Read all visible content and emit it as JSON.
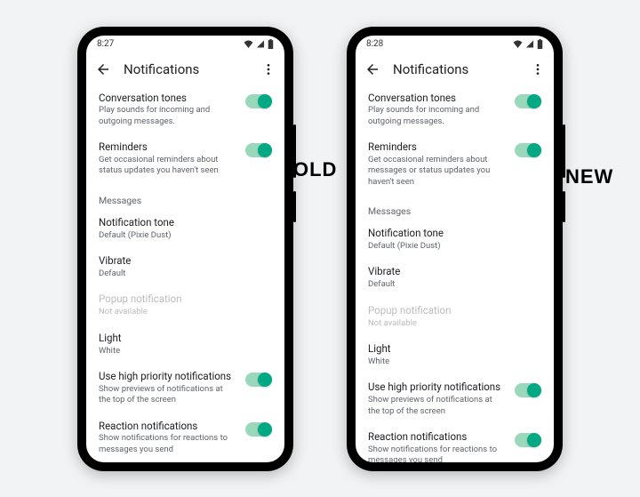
{
  "badges": {
    "old": "OLD",
    "new": "NEW"
  },
  "phones": [
    {
      "id": "old",
      "status_time": "8:27",
      "title": "Notifications",
      "settings": {
        "conv_title": "Conversation tones",
        "conv_sub": "Play sounds for incoming and outgoing messages.",
        "rem_title": "Reminders",
        "rem_sub": "Get occasional reminders about status updates you haven't seen",
        "section_messages": "Messages",
        "tone_title": "Notification tone",
        "tone_sub": "Default (Pixie Dust)",
        "vib_title": "Vibrate",
        "vib_sub": "Default",
        "popup_title": "Popup notification",
        "popup_sub": "Not available",
        "light_title": "Light",
        "light_sub": "White",
        "hp_title": "Use high priority notifications",
        "hp_sub": "Show previews of notifications at the top of the screen",
        "react_title": "Reaction notifications",
        "react_sub": "Show notifications for reactions to messages you send"
      }
    },
    {
      "id": "new",
      "status_time": "8:28",
      "title": "Notifications",
      "settings": {
        "conv_title": "Conversation tones",
        "conv_sub": "Play sounds for incoming and outgoing messages.",
        "rem_title": "Reminders",
        "rem_sub": "Get occasional reminders about messages or status updates you haven't seen",
        "section_messages": "Messages",
        "tone_title": "Notification tone",
        "tone_sub": "Default (Pixie Dust)",
        "vib_title": "Vibrate",
        "vib_sub": "Default",
        "popup_title": "Popup notification",
        "popup_sub": "Not available",
        "light_title": "Light",
        "light_sub": "White",
        "hp_title": "Use high priority notifications",
        "hp_sub": "Show previews of notifications at the top of the screen",
        "react_title": "Reaction notifications",
        "react_sub": "Show notifications for reactions to messages you send"
      }
    }
  ]
}
